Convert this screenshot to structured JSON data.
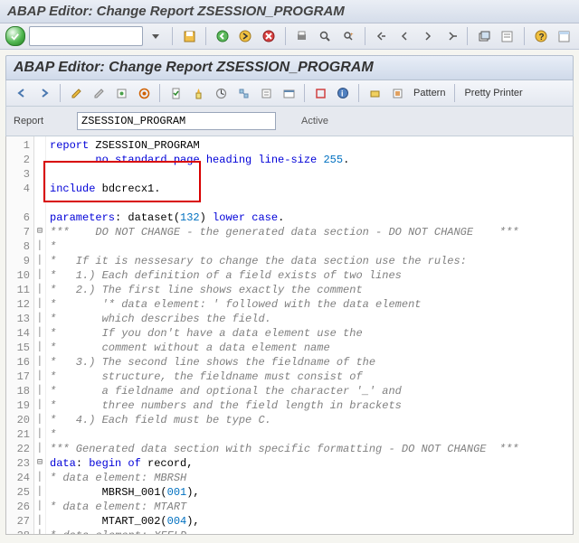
{
  "window": {
    "outer_title": "ABAP Editor: Change Report ZSESSION_PROGRAM",
    "inner_title": "ABAP Editor: Change Report ZSESSION_PROGRAM"
  },
  "sys_toolbar": {
    "ok_icon": "check-icon",
    "cmd_value": "",
    "icons": [
      "save",
      "back",
      "exit",
      "cancel",
      "print",
      "find",
      "find-next",
      "first",
      "prev",
      "next",
      "last",
      "new-session",
      "shortcut",
      "help",
      "layout"
    ]
  },
  "app_toolbar": {
    "groups": [
      [
        "back-arrow",
        "forward-arrow"
      ],
      [
        "toggle",
        "active",
        "other-obj",
        "enhance"
      ],
      [
        "check",
        "activate",
        "execute",
        "where-used",
        "objlist",
        "display-nav",
        "toggle-full",
        "help2"
      ]
    ],
    "pattern_btn": "Pattern",
    "pretty_btn": "Pretty Printer"
  },
  "fields": {
    "report_label": "Report",
    "report_value": "ZSESSION_PROGRAM",
    "status": "Active"
  },
  "code": {
    "lines": [
      {
        "n": 1,
        "f": "",
        "t": [
          [
            "kw",
            "report"
          ],
          [
            "plain",
            " ZSESSION_PROGRAM"
          ]
        ]
      },
      {
        "n": 2,
        "f": "",
        "t": [
          [
            "plain",
            "       "
          ],
          [
            "kw",
            "no standard page heading line-size"
          ],
          [
            "plain",
            " "
          ],
          [
            "num",
            "255"
          ],
          [
            "plain",
            "."
          ]
        ]
      },
      {
        "n": 3,
        "f": "",
        "t": [
          [
            "plain",
            ""
          ]
        ]
      },
      {
        "n": 4,
        "f": "",
        "t": [
          [
            "kw",
            "include"
          ],
          [
            "plain",
            " bdcrecx1."
          ]
        ]
      },
      {
        "n": "",
        "f": "",
        "t": [
          [
            "plain",
            ""
          ]
        ]
      },
      {
        "n": 6,
        "f": "",
        "t": [
          [
            "kw",
            "parameters"
          ],
          [
            "plain",
            ": dataset("
          ],
          [
            "num",
            "132"
          ],
          [
            "plain",
            ") "
          ],
          [
            "kw",
            "lower case"
          ],
          [
            "plain",
            "."
          ]
        ]
      },
      {
        "n": 7,
        "f": "⊟",
        "t": [
          [
            "cmt",
            "***    DO NOT CHANGE - the generated data section - DO NOT CHANGE    ***"
          ]
        ]
      },
      {
        "n": 8,
        "f": "│",
        "t": [
          [
            "cmt",
            "*"
          ]
        ]
      },
      {
        "n": 9,
        "f": "│",
        "t": [
          [
            "cmt",
            "*   If it is nessesary to change the data section use the rules:"
          ]
        ]
      },
      {
        "n": 10,
        "f": "│",
        "t": [
          [
            "cmt",
            "*   1.) Each definition of a field exists of two lines"
          ]
        ]
      },
      {
        "n": 11,
        "f": "│",
        "t": [
          [
            "cmt",
            "*   2.) The first line shows exactly the comment"
          ]
        ]
      },
      {
        "n": 12,
        "f": "│",
        "t": [
          [
            "cmt",
            "*       '* data element: ' followed with the data element"
          ]
        ]
      },
      {
        "n": 13,
        "f": "│",
        "t": [
          [
            "cmt",
            "*       which describes the field."
          ]
        ]
      },
      {
        "n": 14,
        "f": "│",
        "t": [
          [
            "cmt",
            "*       If you don't have a data element use the"
          ]
        ]
      },
      {
        "n": 15,
        "f": "│",
        "t": [
          [
            "cmt",
            "*       comment without a data element name"
          ]
        ]
      },
      {
        "n": 16,
        "f": "│",
        "t": [
          [
            "cmt",
            "*   3.) The second line shows the fieldname of the"
          ]
        ]
      },
      {
        "n": 17,
        "f": "│",
        "t": [
          [
            "cmt",
            "*       structure, the fieldname must consist of"
          ]
        ]
      },
      {
        "n": 18,
        "f": "│",
        "t": [
          [
            "cmt",
            "*       a fieldname and optional the character '_' and"
          ]
        ]
      },
      {
        "n": 19,
        "f": "│",
        "t": [
          [
            "cmt",
            "*       three numbers and the field length in brackets"
          ]
        ]
      },
      {
        "n": 20,
        "f": "│",
        "t": [
          [
            "cmt",
            "*   4.) Each field must be type C."
          ]
        ]
      },
      {
        "n": 21,
        "f": "│",
        "t": [
          [
            "cmt",
            "*"
          ]
        ]
      },
      {
        "n": 22,
        "f": "│",
        "t": [
          [
            "cmt",
            "*** Generated data section with specific formatting - DO NOT CHANGE  ***"
          ]
        ]
      },
      {
        "n": 23,
        "f": "⊟",
        "t": [
          [
            "kw",
            "data"
          ],
          [
            "plain",
            ": "
          ],
          [
            "kw",
            "begin of"
          ],
          [
            "plain",
            " record,"
          ]
        ]
      },
      {
        "n": 24,
        "f": "│",
        "t": [
          [
            "cmt",
            "* data element: MBRSH"
          ]
        ]
      },
      {
        "n": 25,
        "f": "│",
        "t": [
          [
            "plain",
            "        MBRSH_001("
          ],
          [
            "num",
            "001"
          ],
          [
            "plain",
            "),"
          ]
        ]
      },
      {
        "n": 26,
        "f": "│",
        "t": [
          [
            "cmt",
            "* data element: MTART"
          ]
        ]
      },
      {
        "n": 27,
        "f": "│",
        "t": [
          [
            "plain",
            "        MTART_002("
          ],
          [
            "num",
            "004"
          ],
          [
            "plain",
            "),"
          ]
        ]
      },
      {
        "n": 28,
        "f": "│",
        "t": [
          [
            "cmt",
            "* data element: XFELD"
          ]
        ]
      }
    ]
  }
}
